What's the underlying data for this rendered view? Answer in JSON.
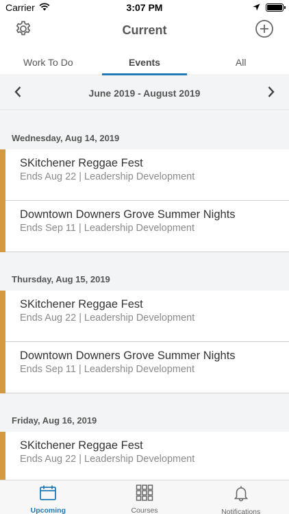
{
  "status_bar": {
    "carrier": "Carrier",
    "time": "3:07 PM"
  },
  "header": {
    "title": "Current",
    "settings_icon": "gear-icon",
    "add_icon": "plus-circle-icon"
  },
  "tabs": [
    {
      "label": "Work To Do",
      "active": false
    },
    {
      "label": "Events",
      "active": true
    },
    {
      "label": "All",
      "active": false
    }
  ],
  "range": {
    "label": "June 2019 - August 2019"
  },
  "days": [
    {
      "date": "Wednesday, Aug 14, 2019",
      "events": [
        {
          "title": "SKitchener Reggae Fest",
          "subtitle": "Ends Aug 22 | Leadership Development"
        },
        {
          "title": "Downtown Downers Grove Summer Nights",
          "subtitle": "Ends Sep 11 | Leadership Development"
        }
      ]
    },
    {
      "date": "Thursday, Aug 15, 2019",
      "events": [
        {
          "title": "SKitchener Reggae Fest",
          "subtitle": "Ends Aug 22 | Leadership Development"
        },
        {
          "title": "Downtown Downers Grove Summer Nights",
          "subtitle": "Ends Sep 11 | Leadership Development"
        }
      ]
    },
    {
      "date": "Friday, Aug 16, 2019",
      "events": [
        {
          "title": "SKitchener Reggae Fest",
          "subtitle": "Ends Aug 22 | Leadership Development"
        }
      ]
    }
  ],
  "bottom_nav": [
    {
      "label": "Upcoming",
      "icon": "calendar-icon",
      "active": true
    },
    {
      "label": "Courses",
      "icon": "grid-icon",
      "active": false
    },
    {
      "label": "Notifications",
      "icon": "bell-icon",
      "active": false
    }
  ],
  "colors": {
    "accent": "#1d79b8",
    "event_bar": "#d39a41"
  }
}
